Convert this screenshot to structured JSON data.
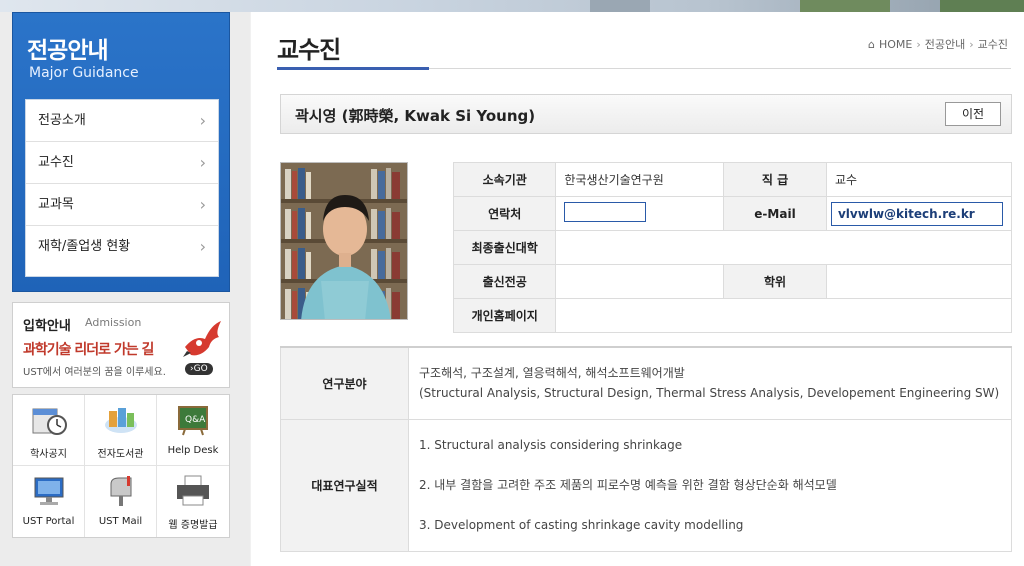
{
  "sidebar": {
    "title_ko": "전공안내",
    "title_en": "Major Guidance",
    "menu": [
      {
        "label": "전공소개"
      },
      {
        "label": "교수진"
      },
      {
        "label": "교과목"
      },
      {
        "label": "재학/졸업생 현황"
      }
    ]
  },
  "admission": {
    "title": "입학안내",
    "subtitle": "Admission",
    "slogan": "과학기술 리더로 가는 길",
    "desc": "UST에서 여러분의 꿈을 이루세요.",
    "go": "GO"
  },
  "quick_links": [
    {
      "label": "학사공지",
      "icon": "clock-calendar-icon"
    },
    {
      "label": "전자도서관",
      "icon": "books-icon"
    },
    {
      "label": "Help Desk",
      "icon": "qa-board-icon"
    },
    {
      "label": "UST Portal",
      "icon": "monitor-icon"
    },
    {
      "label": "UST Mail",
      "icon": "mailbox-icon"
    },
    {
      "label": "웹 증명발급",
      "icon": "printer-icon"
    }
  ],
  "page": {
    "title": "교수진",
    "breadcrumb": [
      "HOME",
      "전공안내",
      "교수진"
    ]
  },
  "professor": {
    "name": "곽시영 (郭時榮, Kwak Si Young)",
    "prev_button": "이전",
    "labels": {
      "org": "소속기관",
      "rank": "직 급",
      "contact": "연락처",
      "email": "e-Mail",
      "school": "최종출신대학",
      "major": "출신전공",
      "degree": "학위",
      "homepage": "개인홈페이지"
    },
    "org": "한국생산기술연구원",
    "rank": "교수",
    "email": "vlvwlw@kitech.re.kr"
  },
  "research": {
    "field_label": "연구분야",
    "field_ko": "구조해석, 구조설계, 열응력해석, 해석소프트웨어개발",
    "field_en": "(Structural Analysis, Structural Design, Thermal Stress Analysis, Developement Engineering SW)",
    "pub_label": "대표연구실적",
    "publications": [
      "1. Structural analysis considering shrinkage",
      "2. 내부 결함을 고려한 주조 제품의 피로수명 예측을 위한 결함 형상단순화 해석모델",
      "3. Development of casting shrinkage cavity modelling"
    ]
  }
}
